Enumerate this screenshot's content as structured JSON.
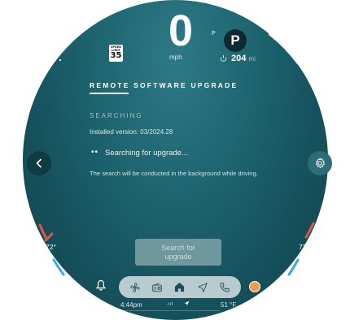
{
  "cluster": {
    "speed": "0",
    "speed_unit": "mph",
    "speed_limit_label": "SPEED LIMIT",
    "speed_limit_value": "35",
    "gear_small": "P",
    "gear": "P",
    "range_value": "204",
    "range_unit": "mi"
  },
  "page": {
    "title": "REMOTE SOFTWARE UPGRADE",
    "section": "SEARCHING",
    "installed": "Installed version: 03/2024.28",
    "status_dots": "••",
    "status": "Searching for upgrade...",
    "note": "The search will be conducted in the background while driving.",
    "search_button_line1": "Search for",
    "search_button_line2": "upgrade"
  },
  "climate": {
    "left_temp": "72°",
    "right_temp": "72°",
    "hot_color": "#e0574a",
    "cold_color": "#3aa7e8"
  },
  "status_bar": {
    "time": "4:44pm",
    "signal": ".ııl",
    "outside_temp": "51 °F"
  },
  "icons": {
    "back": "chevron-left-icon",
    "settings": "gear-icon",
    "notification": "bell-icon",
    "dock": [
      "fan-icon",
      "radio-icon",
      "home-icon",
      "navigation-icon",
      "phone-icon"
    ],
    "profile": "profile-dot-icon"
  },
  "colors": {
    "accent_orange": "#f39a4a",
    "disc_center": "#2d7a86",
    "disc_edge": "#0f414b"
  }
}
